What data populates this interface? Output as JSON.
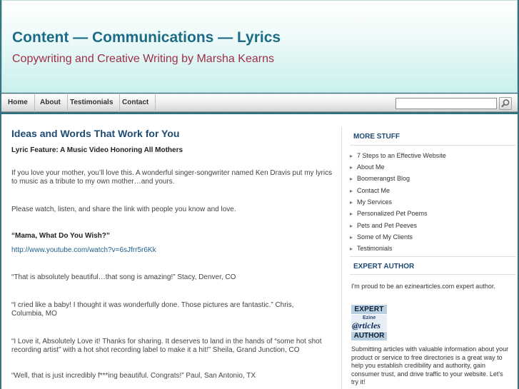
{
  "header": {
    "title": "Content — Communications — Lyrics",
    "tagline": "Copywriting and Creative Writing by Marsha Kearns"
  },
  "nav": {
    "items": [
      "Home",
      "About",
      "Testimonials",
      "Contact"
    ],
    "search_value": ""
  },
  "post": {
    "title": "Ideas and Words That Work for You",
    "subtitle": "Lyric Feature: A Music Video Honoring All Mothers",
    "paragraphs": [
      "If you love your mother, you’ll love this. A wonderful singer-songwriter named Ken Dravis put my lyrics to music as a tribute to my own mother…and yours.",
      "Please watch, listen, and share the link with people you know and love.",
      "“Mama, What Do You Wish?”",
      "http://www.youtube.com/watch?v=6sJfrr5r6Kk",
      "“That is absolutely beautiful…that song is amazing!” Stacy, Denver, CO",
      "“I cried like a baby! I thought it was wonderfully done. Those pictures are fantastic.” Chris, Columbia, MO",
      "“I Love it,  Absolutely Love it! Thanks for sharing. It deserves to land in the hands of “some hot shot recording artist” with a hot shot recording label to make it a hit!” Sheila, Grand Junction, CO",
      "“Well, that is just incredibly f***ing beautiful. Congrats!” Paul, San Antonio, TX"
    ]
  },
  "sidebar": {
    "more_heading": "MORE STUFF",
    "more_items": [
      "7 Steps to an Effective Website",
      "About Me",
      "Boomerangst Blog",
      "Contact Me",
      "My Services",
      "Personalized Pet Poems",
      "Pets and Pet Peeves",
      "Some of My Clients",
      "Testimonials"
    ],
    "expert_heading": "EXPERT AUTHOR",
    "expert_intro": "I'm proud to be an ezinearticles.com expert author.",
    "badge": {
      "top": "EXPERT",
      "mid_small": "Ezine",
      "mid": "@rticles",
      "bottom": "AUTHOR"
    },
    "expert_body": "Submitting articles with valuable information about your product or service to free directories is a great way to help you establish credibility and authority, gain consumer trust, and drive traffic to your website. Let's try it!"
  },
  "colors": {
    "title": "#1d6c86",
    "tagline": "#9e2f45",
    "heading": "#1f4b73",
    "link": "#1f5f8b"
  }
}
